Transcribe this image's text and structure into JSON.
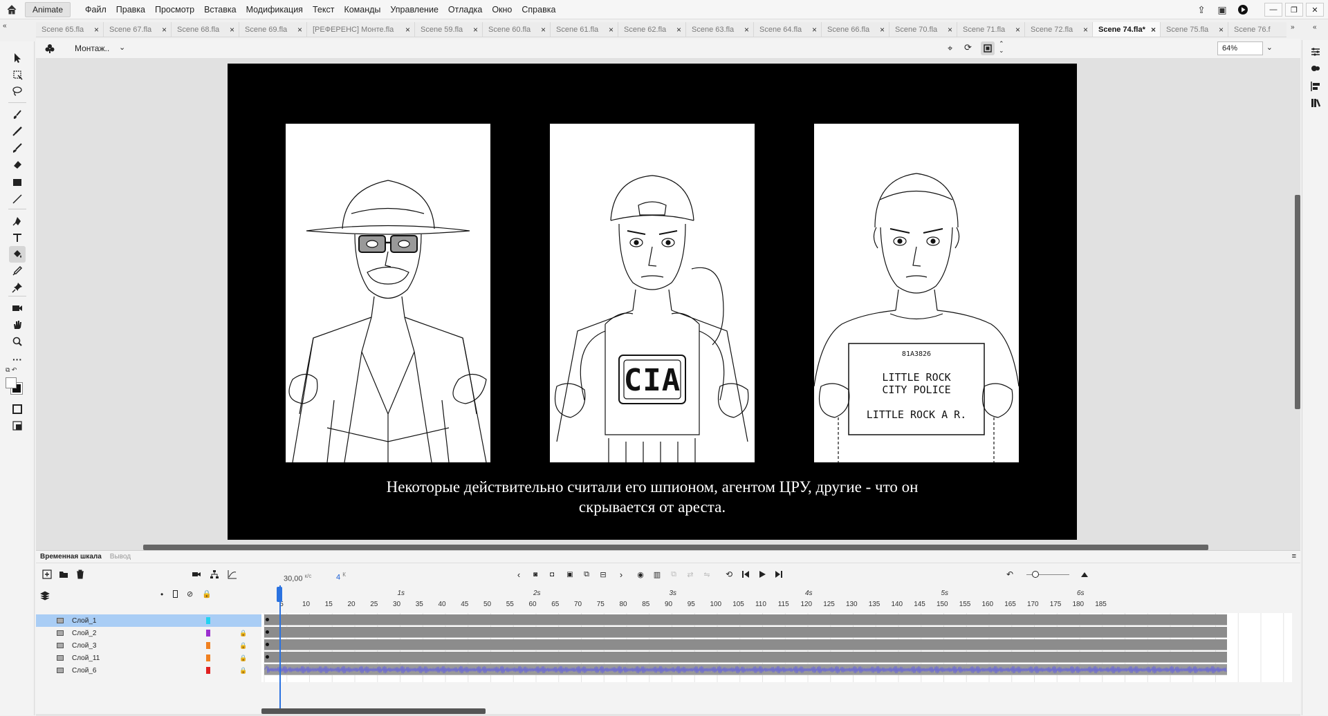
{
  "app": {
    "name": "Animate",
    "menu": [
      "Файл",
      "Правка",
      "Просмотр",
      "Вставка",
      "Модификация",
      "Текст",
      "Команды",
      "Управление",
      "Отладка",
      "Окно",
      "Справка"
    ]
  },
  "tabs": [
    {
      "label": "Scene 65.fla",
      "active": false
    },
    {
      "label": "Scene 67.fla",
      "active": false
    },
    {
      "label": "Scene 68.fla",
      "active": false
    },
    {
      "label": "Scene 69.fla",
      "active": false
    },
    {
      "label": "[РЕФЕРЕНС] Монте.fla",
      "active": false
    },
    {
      "label": "Scene 59.fla",
      "active": false
    },
    {
      "label": "Scene 60.fla",
      "active": false
    },
    {
      "label": "Scene 61.fla",
      "active": false
    },
    {
      "label": "Scene 62.fla",
      "active": false
    },
    {
      "label": "Scene 63.fla",
      "active": false
    },
    {
      "label": "Scene 64.fla",
      "active": false
    },
    {
      "label": "Scene 66.fla",
      "active": false
    },
    {
      "label": "Scene 70.fla",
      "active": false
    },
    {
      "label": "Scene 71.fla",
      "active": false
    },
    {
      "label": "Scene 72.fla",
      "active": false
    },
    {
      "label": "Scene 74.fla*",
      "active": true
    },
    {
      "label": "Scene 75.fla",
      "active": false
    },
    {
      "label": "Scene 76.f",
      "active": false
    }
  ],
  "editbar": {
    "scene_name": "Монтаж..",
    "zoom": "64%"
  },
  "stage": {
    "caption_line1": "Некоторые действительно считали его шпионом, агентом ЦРУ, другие - что он",
    "caption_line2": "скрывается от ареста.",
    "panel2_vest_text": "CIA",
    "panel3_sign_id": "81A3826",
    "panel3_sign_line1": "LITTLE ROCK",
    "panel3_sign_line2": "CITY POLICE",
    "panel3_sign_line3": "LITTLE ROCK A R."
  },
  "timeline": {
    "tab_timeline": "Временная шкала",
    "tab_output": "Вывод",
    "fps": "30,00",
    "fps_unit": "к/с",
    "current_frame": "4",
    "frame_unit": "К",
    "ruler_numbers": [
      "5",
      "10",
      "15",
      "20",
      "25",
      "30",
      "35",
      "40",
      "45",
      "50",
      "55",
      "60",
      "65",
      "70",
      "75",
      "80",
      "85",
      "90",
      "95",
      "100",
      "105",
      "110",
      "115",
      "120",
      "125",
      "130",
      "135",
      "140",
      "145",
      "150",
      "155",
      "160",
      "165",
      "170",
      "175",
      "180",
      "185"
    ],
    "seconds": [
      "1s",
      "2s",
      "3s",
      "4s",
      "5s",
      "6s"
    ],
    "layers": [
      {
        "name": "Слой_1",
        "color": "#22d3f0",
        "locked": false,
        "selected": true
      },
      {
        "name": "Слой_2",
        "color": "#9b2fcf",
        "locked": true,
        "selected": false
      },
      {
        "name": "Слой_3",
        "color": "#f08020",
        "locked": true,
        "selected": false
      },
      {
        "name": "Слой_11",
        "color": "#f08020",
        "locked": true,
        "selected": false
      },
      {
        "name": "Слой_6",
        "color": "#e02020",
        "locked": true,
        "selected": false
      }
    ]
  },
  "colors": {
    "accent": "#2a72e0",
    "stage_bg": "#000000",
    "pasteboard": "#e1e1e1"
  }
}
